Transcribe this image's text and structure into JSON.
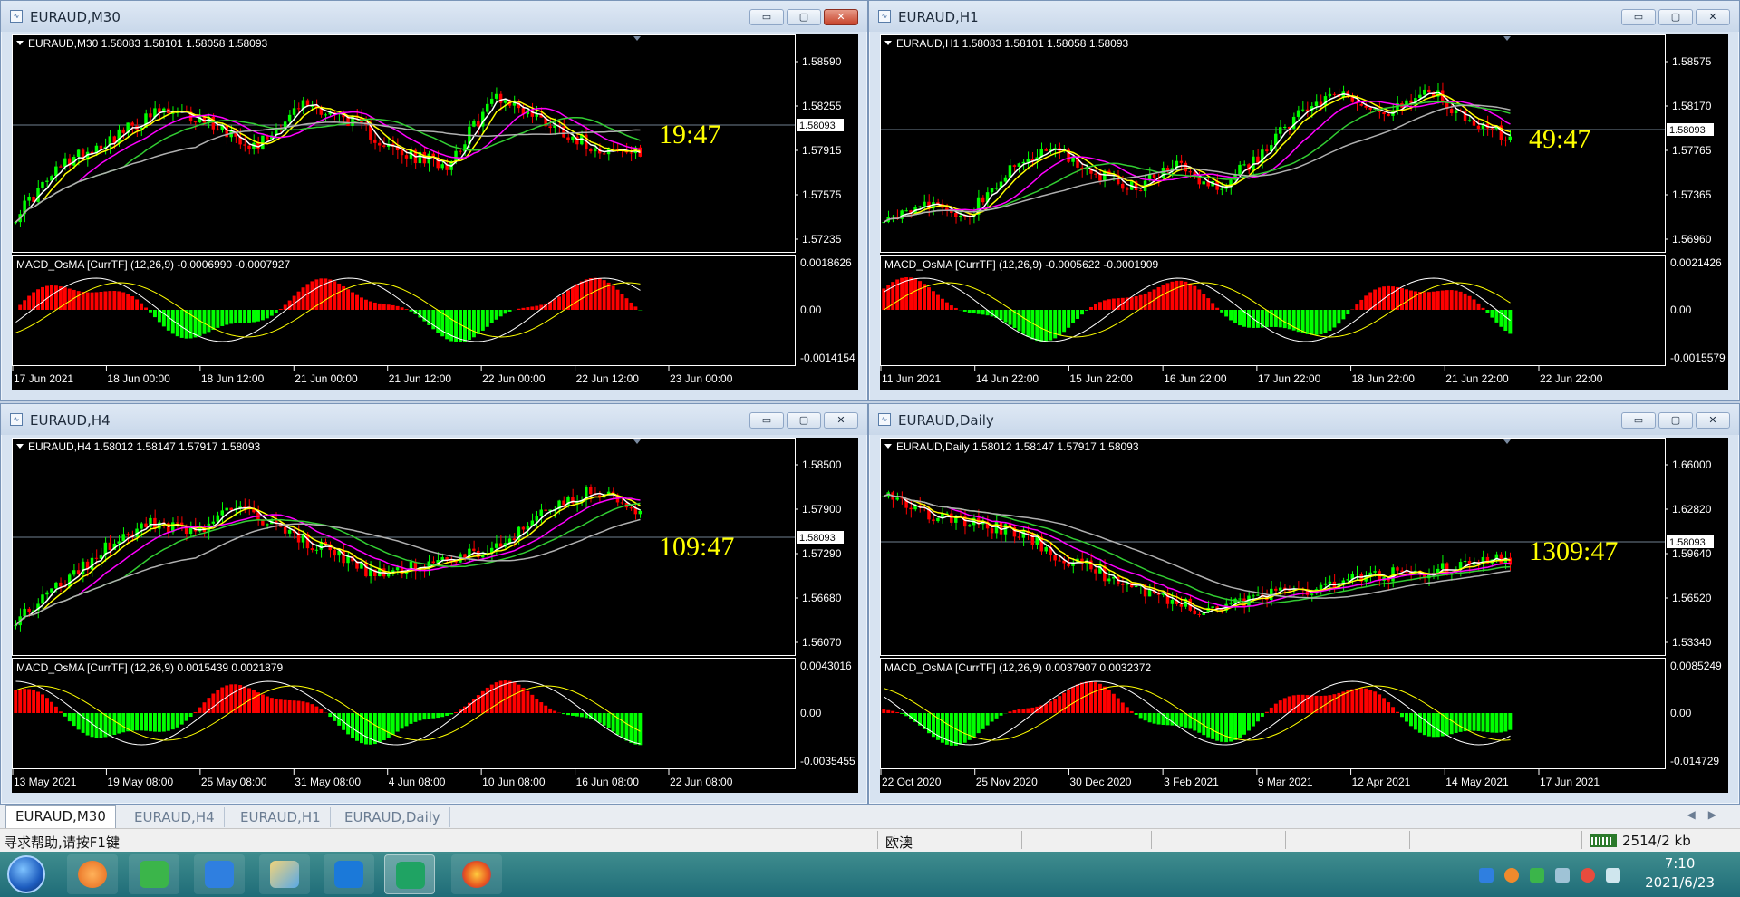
{
  "windows": [
    {
      "id": "m30",
      "title": "EURAUD,M30",
      "header": "EURAUD,M30  1.58083 1.58101 1.58058 1.58093",
      "price_ticks": [
        "1.58590",
        "1.58255",
        "1.57915",
        "1.57575",
        "1.57235"
      ],
      "current_price": "1.58093",
      "countdown": "19:47",
      "indicator": "MACD_OsMA [CurrTF] (12,26,9) -0.0006990 -0.0007927",
      "ind_ticks": [
        "0.0018626",
        "0.00",
        "-0.0014154"
      ],
      "time_labels": [
        "17 Jun 2021",
        "18 Jun 00:00",
        "18 Jun 12:00",
        "21 Jun 00:00",
        "21 Jun 12:00",
        "22 Jun 00:00",
        "22 Jun 12:00",
        "23 Jun 00:00"
      ],
      "buttons": [
        "▭",
        "▢",
        "✕"
      ]
    },
    {
      "id": "h1",
      "title": "EURAUD,H1",
      "header": "EURAUD,H1  1.58083 1.58101 1.58058 1.58093",
      "price_ticks": [
        "1.58575",
        "1.58170",
        "1.57765",
        "1.57365",
        "1.56960"
      ],
      "current_price": "1.58093",
      "countdown": "49:47",
      "indicator": "MACD_OsMA [CurrTF] (12,26,9) -0.0005622 -0.0001909",
      "ind_ticks": [
        "0.0021426",
        "0.00",
        "-0.0015579"
      ],
      "time_labels": [
        "11 Jun 2021",
        "14 Jun 22:00",
        "15 Jun 22:00",
        "16 Jun 22:00",
        "17 Jun 22:00",
        "18 Jun 22:00",
        "21 Jun 22:00",
        "22 Jun 22:00"
      ],
      "buttons": [
        "▭",
        "▢",
        "✕"
      ]
    },
    {
      "id": "h4",
      "title": "EURAUD,H4",
      "header": "EURAUD,H4  1.58012 1.58147 1.57917 1.58093",
      "price_ticks": [
        "1.58500",
        "1.57900",
        "1.57290",
        "1.56680",
        "1.56070"
      ],
      "current_price": "1.58093",
      "countdown": "109:47",
      "indicator": "MACD_OsMA [CurrTF] (12,26,9) 0.0015439 0.0021879",
      "ind_ticks": [
        "0.0043016",
        "0.00",
        "-0.0035455"
      ],
      "time_labels": [
        "13 May 2021",
        "19 May 08:00",
        "25 May 08:00",
        "31 May 08:00",
        "4 Jun 08:00",
        "10 Jun 08:00",
        "16 Jun 08:00",
        "22 Jun 08:00"
      ],
      "buttons": [
        "▭",
        "▢",
        "✕"
      ]
    },
    {
      "id": "d1",
      "title": "EURAUD,Daily",
      "header": "EURAUD,Daily  1.58012 1.58147 1.57917 1.58093",
      "price_ticks": [
        "1.66000",
        "1.62820",
        "1.59640",
        "1.56520",
        "1.53340"
      ],
      "current_price": "1.58093",
      "countdown": "1309:47",
      "indicator": "MACD_OsMA [CurrTF] (12,26,9) 0.0037907 0.0032372",
      "ind_ticks": [
        "0.0085249",
        "0.00",
        "-0.014729"
      ],
      "time_labels": [
        "22 Oct 2020",
        "25 Nov 2020",
        "30 Dec 2020",
        "3 Feb 2021",
        "9 Mar 2021",
        "12 Apr 2021",
        "14 May 2021",
        "17 Jun 2021"
      ],
      "buttons": [
        "▭",
        "▢",
        "✕"
      ]
    }
  ],
  "tabs": [
    "EURAUD,M30",
    "EURAUD,H4",
    "EURAUD,H1",
    "EURAUD,Daily"
  ],
  "tab_arrows": "◀▶",
  "status": {
    "help": "寻求帮助,请按F1键",
    "symbol": "欧澳",
    "traffic": "2514/2 kb"
  },
  "taskbar": {
    "time": "7:10",
    "date": "2021/6/23"
  },
  "colors": {
    "bull": "#00ff00",
    "bear": "#ff0000",
    "ma_white": "#ffffff",
    "ma_yellow": "#ffff00",
    "ma_magenta": "#ff00ff",
    "ma_green": "#32cd32",
    "ma_gray": "#b0b0b0",
    "countdown": "#ffff00"
  }
}
